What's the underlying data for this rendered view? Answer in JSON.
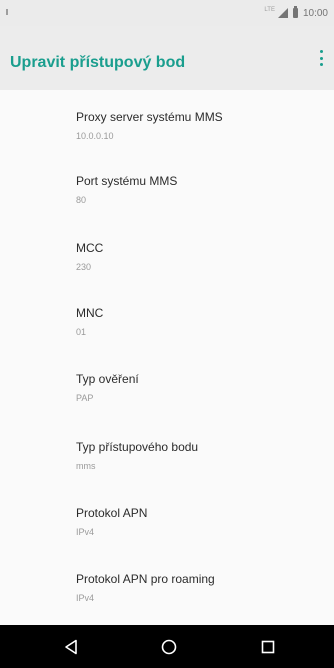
{
  "status_bar": {
    "network": "LTE",
    "time": "10:00"
  },
  "app_bar": {
    "title": "Upravit přístupový bod",
    "menu_icon": "more-vert-icon"
  },
  "settings": [
    {
      "label": "Proxy server systému MMS",
      "value": "10.0.0.10"
    },
    {
      "label": "Port systému MMS",
      "value": "80"
    },
    {
      "label": "MCC",
      "value": "230"
    },
    {
      "label": "MNC",
      "value": "01"
    },
    {
      "label": "Typ ověření",
      "value": "PAP"
    },
    {
      "label": "Typ přístupového bodu",
      "value": "mms"
    },
    {
      "label": "Protokol APN",
      "value": "IPv4"
    },
    {
      "label": "Protokol APN pro roaming",
      "value": "IPv4"
    }
  ],
  "nav_bar": {
    "back_icon": "back-triangle-icon",
    "home_icon": "home-circle-icon",
    "recents_icon": "recents-square-icon"
  },
  "colors": {
    "accent": "#1a9e8e",
    "app_bar": "#ececec",
    "status_bar": "#ebebeb",
    "nav_bar": "#000000"
  }
}
